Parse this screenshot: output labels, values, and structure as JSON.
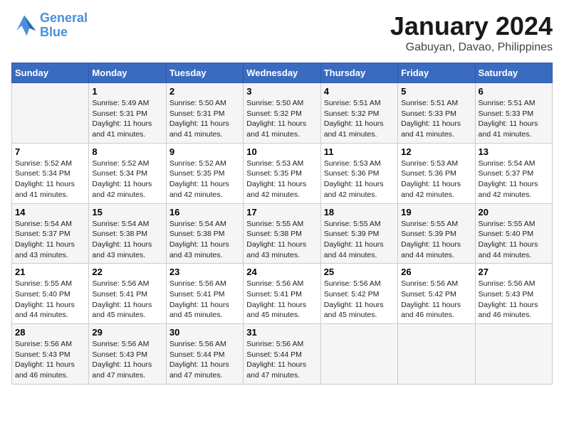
{
  "logo": {
    "line1": "General",
    "line2": "Blue"
  },
  "title": "January 2024",
  "subtitle": "Gabuyan, Davao, Philippines",
  "days_of_week": [
    "Sunday",
    "Monday",
    "Tuesday",
    "Wednesday",
    "Thursday",
    "Friday",
    "Saturday"
  ],
  "weeks": [
    [
      {
        "day": "",
        "info": ""
      },
      {
        "day": "1",
        "info": "Sunrise: 5:49 AM\nSunset: 5:31 PM\nDaylight: 11 hours\nand 41 minutes."
      },
      {
        "day": "2",
        "info": "Sunrise: 5:50 AM\nSunset: 5:31 PM\nDaylight: 11 hours\nand 41 minutes."
      },
      {
        "day": "3",
        "info": "Sunrise: 5:50 AM\nSunset: 5:32 PM\nDaylight: 11 hours\nand 41 minutes."
      },
      {
        "day": "4",
        "info": "Sunrise: 5:51 AM\nSunset: 5:32 PM\nDaylight: 11 hours\nand 41 minutes."
      },
      {
        "day": "5",
        "info": "Sunrise: 5:51 AM\nSunset: 5:33 PM\nDaylight: 11 hours\nand 41 minutes."
      },
      {
        "day": "6",
        "info": "Sunrise: 5:51 AM\nSunset: 5:33 PM\nDaylight: 11 hours\nand 41 minutes."
      }
    ],
    [
      {
        "day": "7",
        "info": "Sunrise: 5:52 AM\nSunset: 5:34 PM\nDaylight: 11 hours\nand 41 minutes."
      },
      {
        "day": "8",
        "info": "Sunrise: 5:52 AM\nSunset: 5:34 PM\nDaylight: 11 hours\nand 42 minutes."
      },
      {
        "day": "9",
        "info": "Sunrise: 5:52 AM\nSunset: 5:35 PM\nDaylight: 11 hours\nand 42 minutes."
      },
      {
        "day": "10",
        "info": "Sunrise: 5:53 AM\nSunset: 5:35 PM\nDaylight: 11 hours\nand 42 minutes."
      },
      {
        "day": "11",
        "info": "Sunrise: 5:53 AM\nSunset: 5:36 PM\nDaylight: 11 hours\nand 42 minutes."
      },
      {
        "day": "12",
        "info": "Sunrise: 5:53 AM\nSunset: 5:36 PM\nDaylight: 11 hours\nand 42 minutes."
      },
      {
        "day": "13",
        "info": "Sunrise: 5:54 AM\nSunset: 5:37 PM\nDaylight: 11 hours\nand 42 minutes."
      }
    ],
    [
      {
        "day": "14",
        "info": "Sunrise: 5:54 AM\nSunset: 5:37 PM\nDaylight: 11 hours\nand 43 minutes."
      },
      {
        "day": "15",
        "info": "Sunrise: 5:54 AM\nSunset: 5:38 PM\nDaylight: 11 hours\nand 43 minutes."
      },
      {
        "day": "16",
        "info": "Sunrise: 5:54 AM\nSunset: 5:38 PM\nDaylight: 11 hours\nand 43 minutes."
      },
      {
        "day": "17",
        "info": "Sunrise: 5:55 AM\nSunset: 5:38 PM\nDaylight: 11 hours\nand 43 minutes."
      },
      {
        "day": "18",
        "info": "Sunrise: 5:55 AM\nSunset: 5:39 PM\nDaylight: 11 hours\nand 44 minutes."
      },
      {
        "day": "19",
        "info": "Sunrise: 5:55 AM\nSunset: 5:39 PM\nDaylight: 11 hours\nand 44 minutes."
      },
      {
        "day": "20",
        "info": "Sunrise: 5:55 AM\nSunset: 5:40 PM\nDaylight: 11 hours\nand 44 minutes."
      }
    ],
    [
      {
        "day": "21",
        "info": "Sunrise: 5:55 AM\nSunset: 5:40 PM\nDaylight: 11 hours\nand 44 minutes."
      },
      {
        "day": "22",
        "info": "Sunrise: 5:56 AM\nSunset: 5:41 PM\nDaylight: 11 hours\nand 45 minutes."
      },
      {
        "day": "23",
        "info": "Sunrise: 5:56 AM\nSunset: 5:41 PM\nDaylight: 11 hours\nand 45 minutes."
      },
      {
        "day": "24",
        "info": "Sunrise: 5:56 AM\nSunset: 5:41 PM\nDaylight: 11 hours\nand 45 minutes."
      },
      {
        "day": "25",
        "info": "Sunrise: 5:56 AM\nSunset: 5:42 PM\nDaylight: 11 hours\nand 45 minutes."
      },
      {
        "day": "26",
        "info": "Sunrise: 5:56 AM\nSunset: 5:42 PM\nDaylight: 11 hours\nand 46 minutes."
      },
      {
        "day": "27",
        "info": "Sunrise: 5:56 AM\nSunset: 5:43 PM\nDaylight: 11 hours\nand 46 minutes."
      }
    ],
    [
      {
        "day": "28",
        "info": "Sunrise: 5:56 AM\nSunset: 5:43 PM\nDaylight: 11 hours\nand 46 minutes."
      },
      {
        "day": "29",
        "info": "Sunrise: 5:56 AM\nSunset: 5:43 PM\nDaylight: 11 hours\nand 47 minutes."
      },
      {
        "day": "30",
        "info": "Sunrise: 5:56 AM\nSunset: 5:44 PM\nDaylight: 11 hours\nand 47 minutes."
      },
      {
        "day": "31",
        "info": "Sunrise: 5:56 AM\nSunset: 5:44 PM\nDaylight: 11 hours\nand 47 minutes."
      },
      {
        "day": "",
        "info": ""
      },
      {
        "day": "",
        "info": ""
      },
      {
        "day": "",
        "info": ""
      }
    ]
  ]
}
